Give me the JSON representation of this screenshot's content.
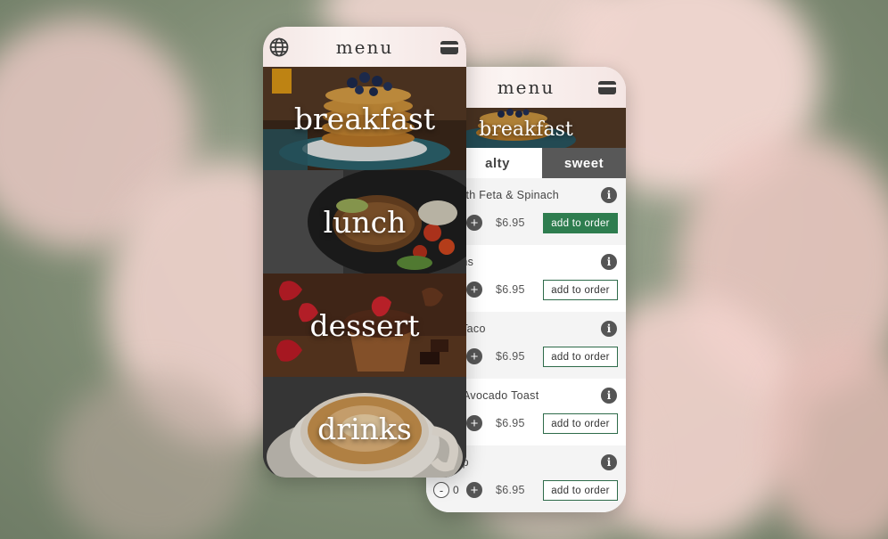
{
  "front": {
    "header": {
      "title": "menu"
    },
    "icons": {
      "left": "globe-icon",
      "right": "card-icon"
    },
    "categories": [
      {
        "label": "breakfast"
      },
      {
        "label": "lunch"
      },
      {
        "label": "dessert"
      },
      {
        "label": "drinks"
      }
    ]
  },
  "back": {
    "header": {
      "title": "menu"
    },
    "icons": {
      "right": "card-icon"
    },
    "banner": {
      "label": "breakfast"
    },
    "tabs": [
      {
        "label": "alty",
        "active": true
      },
      {
        "label": "sweet",
        "active": false
      }
    ],
    "items": [
      {
        "name": "huka with Feta & Spinach",
        "price": "$6.95",
        "button": "add to order",
        "active": true
      },
      {
        "name": "a Muffins",
        "price": "$6.95",
        "button": "add to order",
        "active": false
      },
      {
        "name": "& Egg Taco",
        "price": "$6.95",
        "button": "add to order",
        "active": false
      },
      {
        "name": "Potato Avocado Toast",
        "price": "$6.95",
        "button": "add to order",
        "active": false
      },
      {
        "name": "entil Dip",
        "price": "$6.95",
        "button": "add to order",
        "active": false,
        "minus": "-",
        "qty": "0"
      }
    ],
    "plus_symbol": "+",
    "info_symbol": "i"
  },
  "colors": {
    "accent_green": "#2e7d4f",
    "tab_dark": "#585858",
    "header_pink": "#f5e8e6"
  }
}
